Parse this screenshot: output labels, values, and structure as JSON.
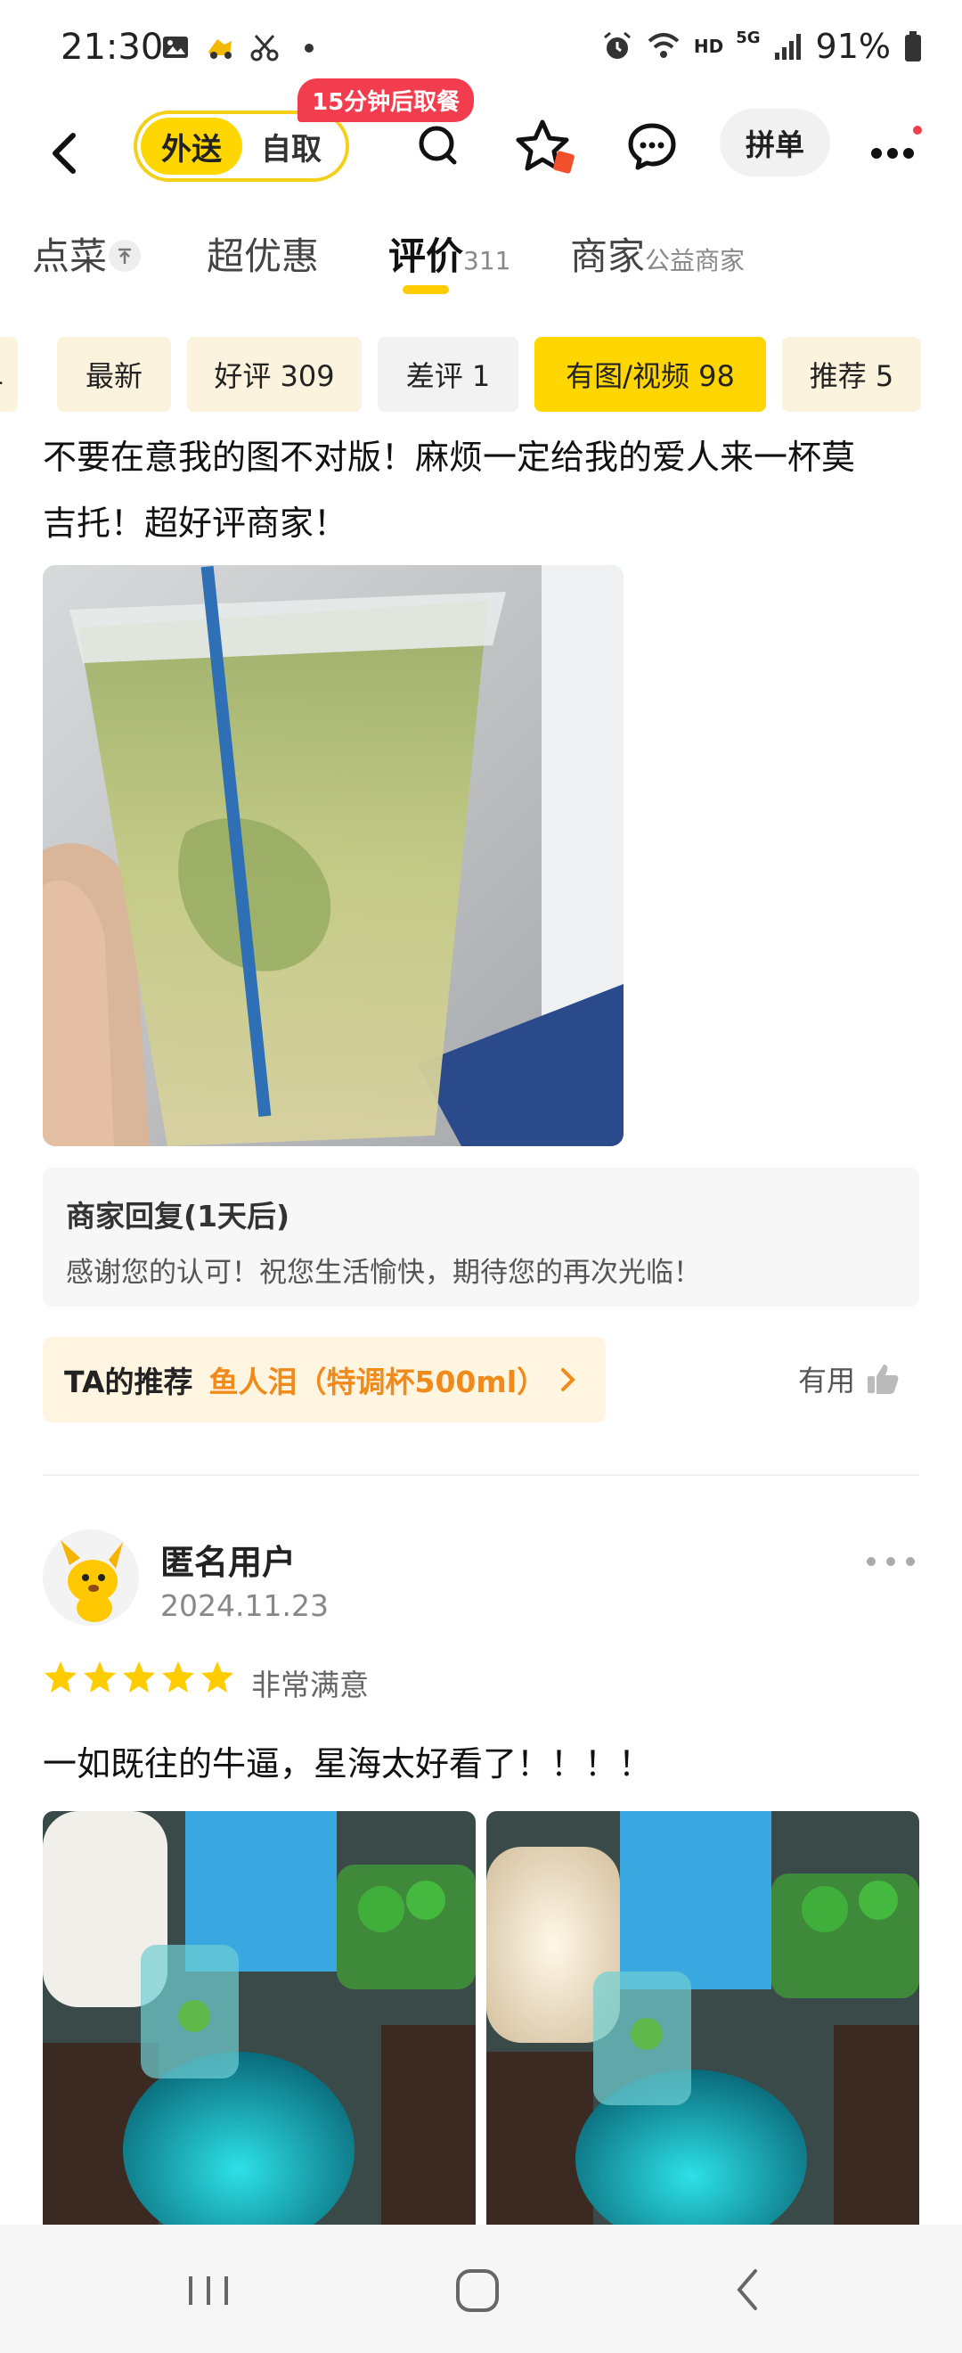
{
  "status_bar": {
    "time": "21:30",
    "network": "HD",
    "signal": "5G",
    "battery": "91%"
  },
  "header": {
    "mode_delivery": "外送",
    "mode_pickup": "自取",
    "pickup_badge": "15分钟后取餐",
    "group_order": "拼单",
    "icons": [
      "back-arrow-icon",
      "search-icon",
      "favorite-star-icon",
      "chat-icon",
      "more-icon"
    ]
  },
  "tabs": [
    {
      "label": "点菜",
      "sub": ""
    },
    {
      "label": "超优惠",
      "sub": ""
    },
    {
      "label": "评价",
      "sub": "311"
    },
    {
      "label": "商家",
      "sub": "公益商家"
    }
  ],
  "filters": [
    {
      "label": "1"
    },
    {
      "label": "最新"
    },
    {
      "label": "好评 309"
    },
    {
      "label": "差评 1"
    },
    {
      "label": "有图/视频 98"
    },
    {
      "label": "推荐 5"
    }
  ],
  "review1": {
    "text_line1": "不要在意我的图不对版！麻烦一定给我的爱人来一杯莫",
    "text_line2": "吉托！超好评商家！",
    "merchant_reply_title": "商家回复(1天后)",
    "merchant_reply_text": "感谢您的认可！祝您生活愉快，期待您的再次光临！",
    "recommend_label": "TA的推荐",
    "recommend_item": "鱼人泪（特调杯500ml）",
    "helpful_label": "有用"
  },
  "review2": {
    "user_name": "匿名用户",
    "date": "2024.11.23",
    "rating": 5,
    "satisfaction": "非常满意",
    "text": "一如既往的牛逼，星海太好看了！！！！"
  },
  "colors": {
    "accent_yellow": "#ffd600",
    "badge_red": "#f23d4f",
    "recommend_orange": "#f08a1a",
    "star_yellow": "#ffcc00"
  }
}
